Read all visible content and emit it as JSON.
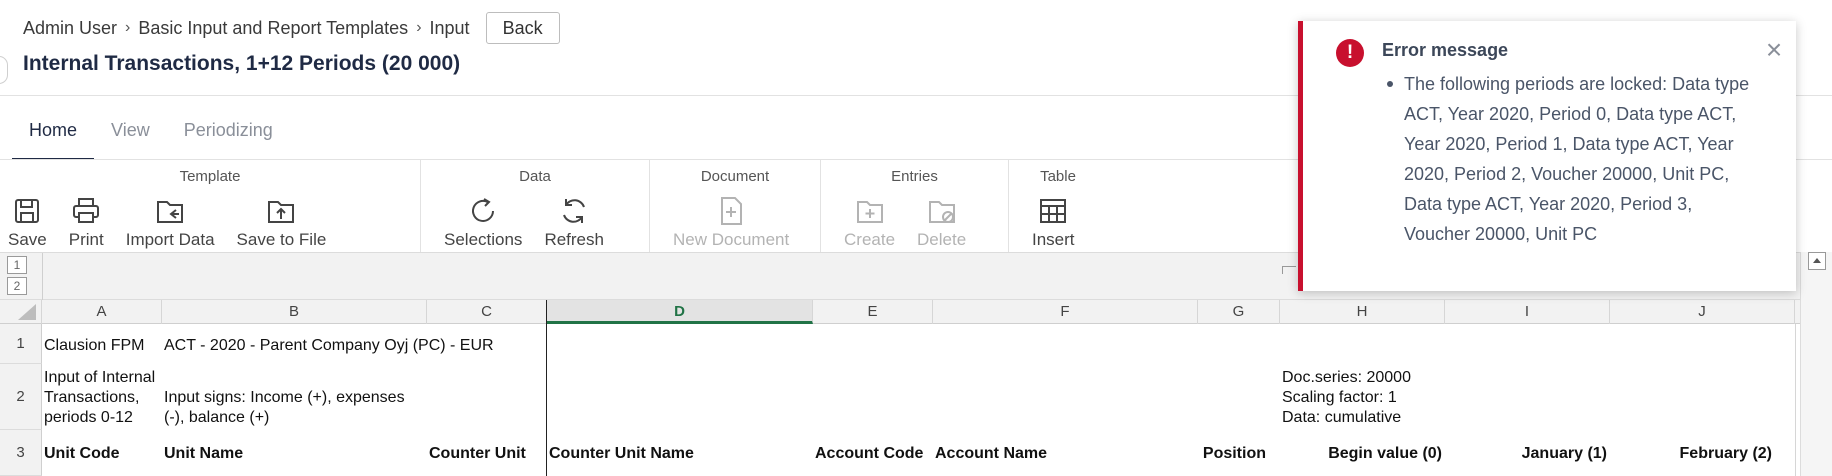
{
  "breadcrumb": [
    "Admin User",
    "Basic Input and Report Templates",
    "Input"
  ],
  "back_label": "Back",
  "page_title": "Internal Transactions, 1+12 Periods (20 000)",
  "tabs": [
    "Home",
    "View",
    "Periodizing"
  ],
  "ribbon": {
    "template": {
      "title": "Template",
      "buttons": [
        "Save",
        "Print",
        "Import Data",
        "Save to File"
      ]
    },
    "data": {
      "title": "Data",
      "buttons": [
        "Selections",
        "Refresh"
      ]
    },
    "document": {
      "title": "Document",
      "buttons": [
        "New Document"
      ]
    },
    "entries": {
      "title": "Entries",
      "buttons": [
        "Create",
        "Delete"
      ]
    },
    "table": {
      "title": "Table",
      "buttons": [
        "Insert"
      ]
    }
  },
  "outline_levels": [
    "1",
    "2"
  ],
  "columns": [
    "A",
    "B",
    "C",
    "D",
    "E",
    "F",
    "G",
    "H",
    "I",
    "J"
  ],
  "rows": [
    "1",
    "2",
    "3"
  ],
  "cells": {
    "a1": "Clausion FPM",
    "b1": "ACT - 2020 - Parent Company Oyj (PC) - EUR",
    "a2": "Input of Internal Transactions, periods 0-12",
    "b2": "Input signs: Income (+), expenses (-), balance (+)",
    "h2_1": "Doc.series: 20000",
    "h2_2": "Scaling factor: 1",
    "h2_3": "Data: cumulative",
    "a3": "Unit Code",
    "b3": "Unit Name",
    "c3": "Counter Unit",
    "d3": "Counter Unit Name",
    "e3": "Account Code",
    "f3": "Account Name",
    "g3": "Position",
    "h3": "Begin value (0)",
    "i3": "January (1)",
    "j3": "February (2)"
  },
  "toast": {
    "title": "Error message",
    "messages": [
      "The following periods are locked: Data type ACT, Year 2020, Period 0, Data type ACT, Year 2020, Period 1, Data type ACT, Year 2020, Period 2, Voucher 20000, Unit PC, Data type ACT, Year 2020, Period 3, Voucher 20000, Unit PC"
    ]
  },
  "colors": {
    "error": "#c8102e",
    "selected_column": "#217346",
    "title": "#1f2a44"
  }
}
